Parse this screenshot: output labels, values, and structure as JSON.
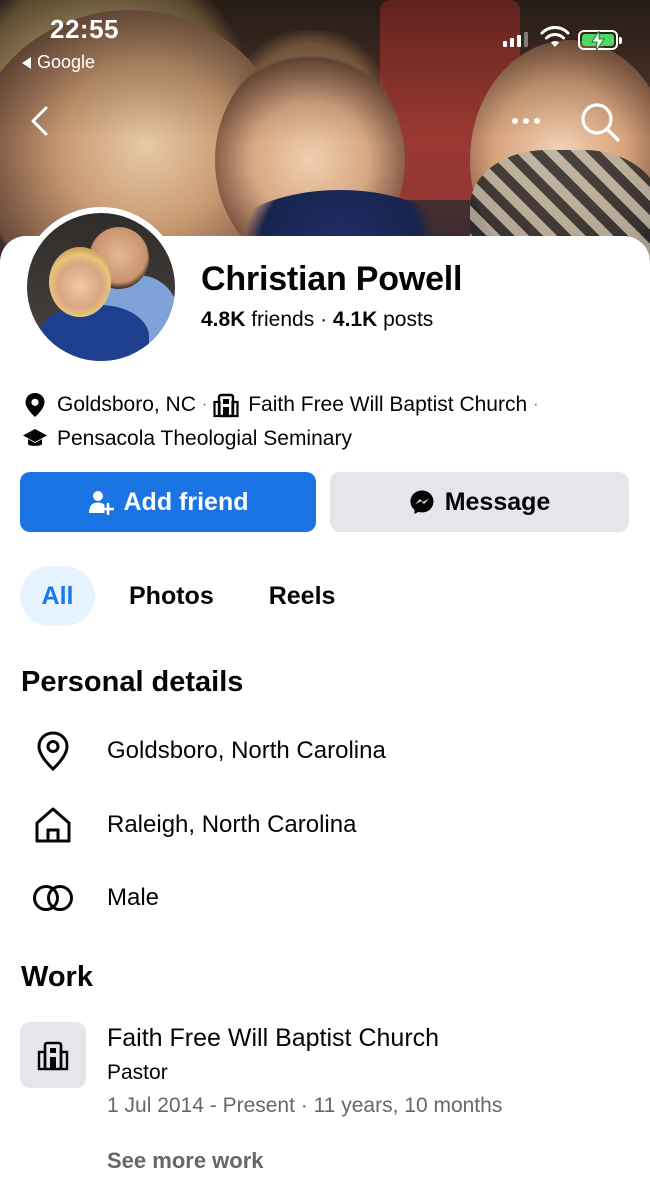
{
  "status_bar": {
    "time": "22:55",
    "back_app": "Google",
    "icons": [
      "signal-icon",
      "wifi-icon",
      "battery-charging-icon"
    ],
    "battery_color": "#4cd964"
  },
  "nav": {
    "icons": [
      "back-chevron-icon",
      "more-dots-icon",
      "search-icon"
    ]
  },
  "profile": {
    "name": "Christian Powell",
    "friends_count": "4.8K",
    "friends_label": " friends",
    "separator": " · ",
    "posts_count": "4.1K",
    "posts_label": " posts"
  },
  "intro": {
    "location": "Goldsboro, NC",
    "workplace": "Faith Free Will Baptist Church",
    "education": "Pensacola Theologial Seminary",
    "dot": "·"
  },
  "actions": {
    "add_friend": "Add friend",
    "message": "Message",
    "primary_color": "#1b74e4"
  },
  "tabs": [
    "All",
    "Photos",
    "Reels"
  ],
  "personal_details": {
    "title": "Personal details",
    "items": [
      {
        "icon": "location-pin-icon",
        "text": "Goldsboro, North Carolina"
      },
      {
        "icon": "home-icon",
        "text": "Raleigh, North Carolina"
      },
      {
        "icon": "gender-icon",
        "text": "Male"
      }
    ]
  },
  "work": {
    "title": "Work",
    "employer": "Faith Free Will Baptist Church",
    "role": "Pastor",
    "dates": "1 Jul 2014 - Present · 11 years, 10 months",
    "see_more": "See more work"
  }
}
